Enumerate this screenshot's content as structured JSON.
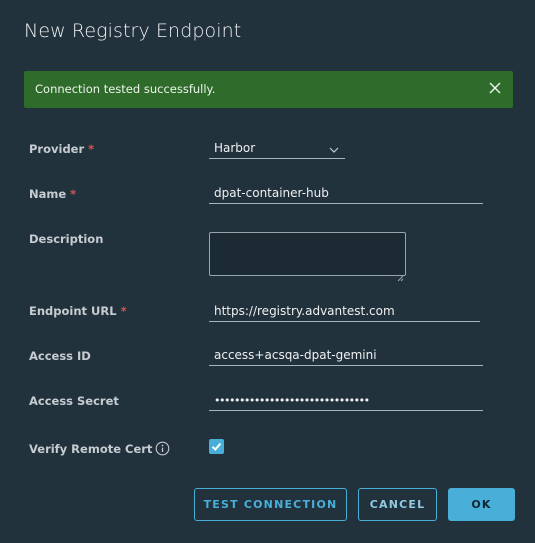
{
  "dialog": {
    "title": "New Registry Endpoint"
  },
  "alert": {
    "message": "Connection tested successfully.",
    "color": "#2f6b2b"
  },
  "form": {
    "provider": {
      "label": "Provider",
      "required": true,
      "value": "Harbor"
    },
    "name": {
      "label": "Name",
      "required": true,
      "value": "dpat-container-hub"
    },
    "description": {
      "label": "Description",
      "required": false,
      "value": ""
    },
    "endpoint_url": {
      "label": "Endpoint URL",
      "required": true,
      "value": "https://registry.advantest.com"
    },
    "access_id": {
      "label": "Access ID",
      "required": false,
      "value": "access+acsqa-dpat-gemini"
    },
    "access_secret": {
      "label": "Access Secret",
      "required": false,
      "value": "•••••••••••••••••••••••••••••••"
    },
    "verify_remote_cert": {
      "label": "Verify Remote Cert",
      "checked": true
    }
  },
  "required_marker": "*",
  "buttons": {
    "test_connection": "TEST CONNECTION",
    "cancel": "CANCEL",
    "ok": "OK"
  },
  "colors": {
    "accent": "#49afd9",
    "background": "#22323c",
    "required": "#d9534f"
  }
}
